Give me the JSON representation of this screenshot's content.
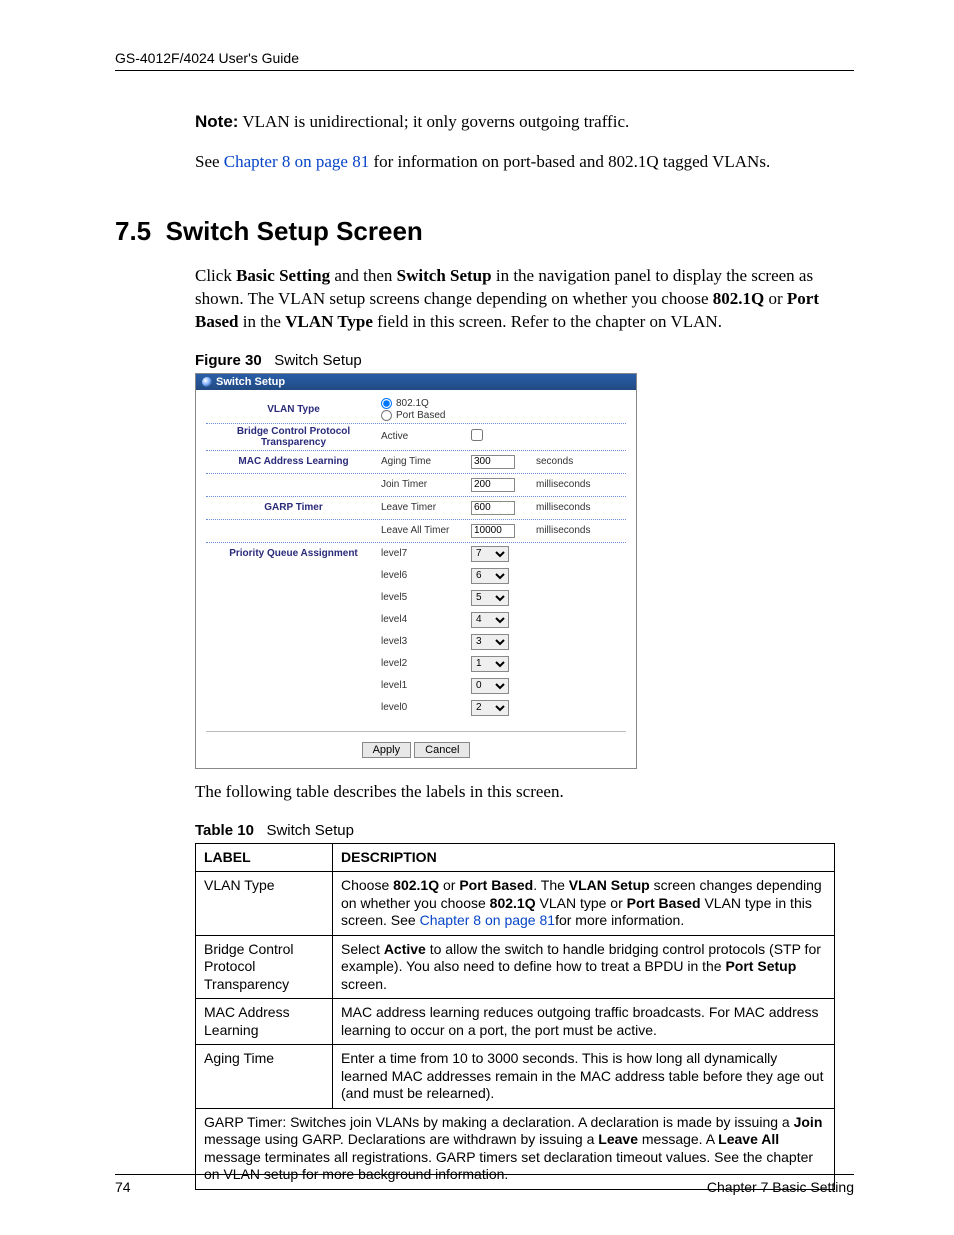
{
  "header": {
    "running": "GS-4012F/4024 User's Guide"
  },
  "note": {
    "label": "Note:",
    "text": " VLAN is unidirectional; it only governs outgoing traffic."
  },
  "see_line": {
    "pre": "See ",
    "link": "Chapter 8 on page 81",
    "post": " for information on port-based and 802.1Q tagged VLANs."
  },
  "section": {
    "number": "7.5",
    "title": "Switch Setup Screen"
  },
  "intro": {
    "p1a": "Click ",
    "p1b": "Basic Setting",
    "p1c": " and then ",
    "p1d": "Switch Setup",
    "p1e": " in the navigation panel to display the screen as shown. The VLAN setup screens change depending on whether you choose ",
    "p1f": "802.1Q",
    "p1g": " or ",
    "p1h": "Port Based",
    "p1i": " in the ",
    "p1j": "VLAN Type",
    "p1k": " field in this screen. Refer to the chapter on VLAN."
  },
  "figure": {
    "label": "Figure 30",
    "caption": "Switch Setup",
    "panel_title": "Switch Setup",
    "vlan_type_label": "VLAN Type",
    "vlan_opt1": "802.1Q",
    "vlan_opt2": "Port Based",
    "bcpt_label": "Bridge Control Protocol Transparency",
    "bcpt_sub": "Active",
    "mac_label": "MAC Address Learning",
    "aging_sub": "Aging Time",
    "aging_val": "300",
    "aging_unit": "seconds",
    "garp_label": "GARP Timer",
    "join_sub": "Join Timer",
    "join_val": "200",
    "join_unit": "milliseconds",
    "leave_sub": "Leave Timer",
    "leave_val": "600",
    "leave_unit": "milliseconds",
    "leaveall_sub": "Leave All Timer",
    "leaveall_val": "10000",
    "leaveall_unit": "milliseconds",
    "pqa_label": "Priority Queue Assignment",
    "levels": [
      {
        "name": "level7",
        "val": "7"
      },
      {
        "name": "level6",
        "val": "6"
      },
      {
        "name": "level5",
        "val": "5"
      },
      {
        "name": "level4",
        "val": "4"
      },
      {
        "name": "level3",
        "val": "3"
      },
      {
        "name": "level2",
        "val": "1"
      },
      {
        "name": "level1",
        "val": "0"
      },
      {
        "name": "level0",
        "val": "2"
      }
    ],
    "apply": "Apply",
    "cancel": "Cancel"
  },
  "after_figure": "The following table describes the labels in this screen.",
  "table": {
    "label": "Table 10",
    "caption": "Switch Setup",
    "head_label": "LABEL",
    "head_desc": "DESCRIPTION",
    "rows": [
      {
        "label": "VLAN Type",
        "d1": "Choose ",
        "d2": "802.1Q",
        "d3": " or ",
        "d4": "Port Based",
        "d5": ". The ",
        "d6": "VLAN Setup",
        "d7": " screen changes depending on whether you choose ",
        "d8": "802.1Q",
        "d9": " VLAN type or ",
        "d10": "Port Based",
        "d11": " VLAN type in this screen. See ",
        "link": "Chapter 8 on page 81",
        "d12": "for more information."
      },
      {
        "label": "Bridge Control Protocol Transparency",
        "d1": "Select ",
        "d2": "Active",
        "d3": " to allow the switch to handle bridging control protocols (STP for example). You also need to define how to treat a BPDU in the ",
        "d4": "Port Setup",
        "d5": " screen."
      },
      {
        "label": "MAC Address Learning",
        "d1": "MAC address learning reduces outgoing traffic broadcasts. For MAC address learning to occur on a port, the port must be active."
      },
      {
        "label": "Aging Time",
        "d1": "Enter a time from 10 to 3000 seconds. This is how long all dynamically learned MAC addresses remain in the MAC address table before they age out (and must be relearned)."
      }
    ],
    "garp_note": {
      "a": "GARP Timer: Switches join VLANs by making a declaration. A declaration is made by issuing a ",
      "b": "Join",
      "c": " message using GARP. Declarations are withdrawn by issuing a ",
      "d": "Leave",
      "e": " message. A ",
      "f": "Leave All",
      "g": " message terminates all registrations. GARP timers set declaration timeout values. See the chapter on VLAN setup for more background information."
    }
  },
  "footer": {
    "page": "74",
    "chapter": "Chapter 7 Basic Setting"
  }
}
